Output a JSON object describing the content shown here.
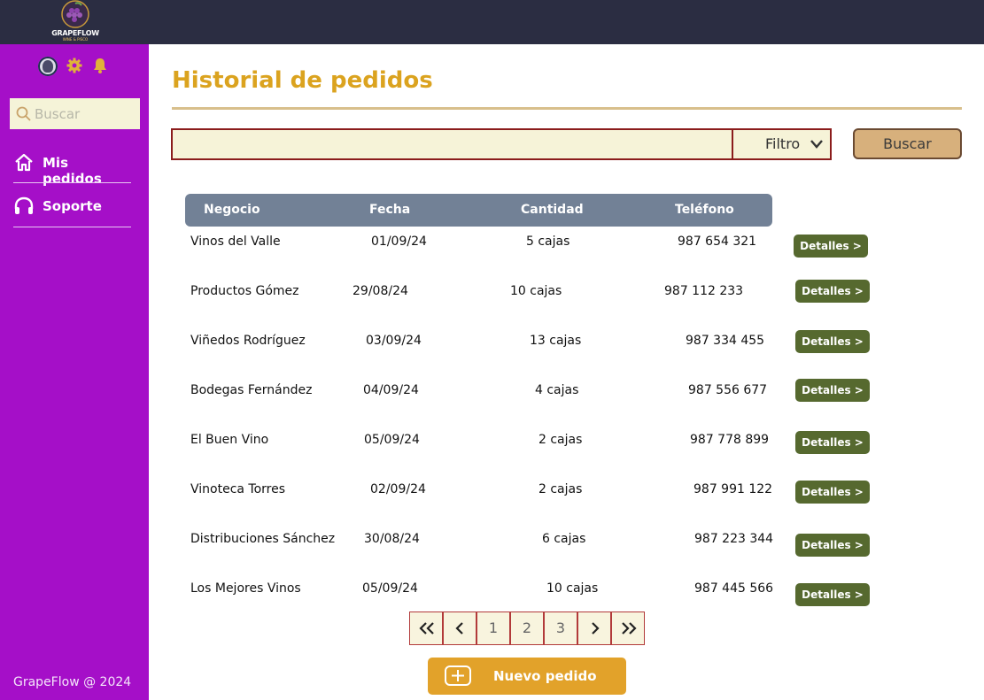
{
  "brand": {
    "name": "GRAPEFLOW",
    "tagline": "WINE & PISCO"
  },
  "sidebar": {
    "search_placeholder": "Buscar",
    "nav": [
      {
        "label": "Mis pedidos",
        "icon": "home-icon"
      },
      {
        "label": "Soporte",
        "icon": "headset-icon"
      }
    ],
    "footer": "GrapeFlow  @ 2024"
  },
  "main": {
    "title": "Historial de pedidos",
    "filter_label": "Filtro",
    "search_button": "Buscar",
    "columns": [
      "Negocio",
      "Fecha",
      "Cantidad",
      "Teléfono"
    ],
    "details_label": "Detalles >",
    "rows": [
      {
        "negocio": "Vinos del Valle",
        "fecha": "01/09/24",
        "cantidad": "5 cajas",
        "telefono": "987 654 321"
      },
      {
        "negocio": "Productos Gómez",
        "fecha": "29/08/24",
        "cantidad": "10 cajas",
        "telefono": "987 112 233"
      },
      {
        "negocio": "Viñedos Rodríguez",
        "fecha": "03/09/24",
        "cantidad": "13 cajas",
        "telefono": "987 334 455"
      },
      {
        "negocio": "Bodegas Fernández",
        "fecha": "04/09/24",
        "cantidad": "4 cajas",
        "telefono": "987 556 677"
      },
      {
        "negocio": "El Buen Vino",
        "fecha": "05/09/24",
        "cantidad": "2 cajas",
        "telefono": "987 778 899"
      },
      {
        "negocio": "Vinoteca Torres",
        "fecha": "02/09/24",
        "cantidad": "2 cajas",
        "telefono": "987 991 122"
      },
      {
        "negocio": "Distribuciones Sánchez",
        "fecha": "30/08/24",
        "cantidad": "6 cajas",
        "telefono": "987 223 344"
      },
      {
        "negocio": "Los Mejores Vinos",
        "fecha": "05/09/24",
        "cantidad": "10 cajas",
        "telefono": "987 445 566"
      }
    ],
    "pagination": {
      "pages": [
        "1",
        "2",
        "3"
      ]
    },
    "new_order_button": "Nuevo pedido"
  },
  "colors": {
    "topbar": "#2b2d42",
    "sidebar": "#a50fc8",
    "title": "#dba31f",
    "table_header": "#728196",
    "details_button": "#56692f",
    "new_order_button": "#e2a22a"
  }
}
